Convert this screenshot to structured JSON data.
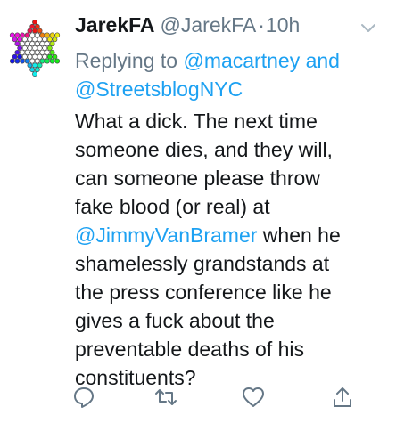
{
  "tweet": {
    "display_name": "JarekFA",
    "handle": "@JarekFA",
    "separator": "·",
    "time": "10h",
    "replying": {
      "prefix": "Replying to",
      "user1": "@macartney",
      "conj": "and",
      "user2": "@StreetsblogNYC"
    },
    "lines": {
      "l1": "What a dick. The next time",
      "l2": "someone dies, and they will,",
      "l3": "can someone please throw",
      "l4": "fake blood (or real) at",
      "mention": "@JimmyVanBramer",
      "l5_rest": " when he",
      "l6": "shamelessly grandstands at",
      "l7": "the press conference like he",
      "l8": "gives a fuck about the",
      "l9": "preventable deaths of his",
      "l10": "constituents?"
    }
  },
  "icons": {
    "avatar": "rainbow-star-of-david-icon",
    "caret": "chevron-down-icon",
    "reply": "reply-bubble-icon",
    "retweet": "retweet-icon",
    "like": "heart-icon",
    "share": "share-icon"
  },
  "colors": {
    "link": "#1da1f2",
    "muted": "#657786",
    "text": "#14171a"
  }
}
